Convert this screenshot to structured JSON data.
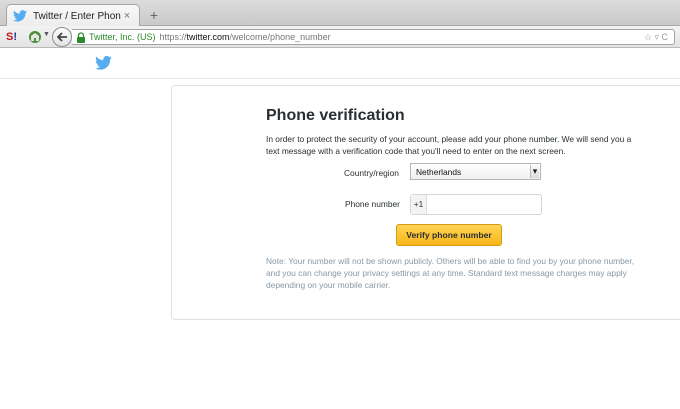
{
  "browser": {
    "tab_title": "Twitter / Enter Phone Number",
    "tab_close": "×",
    "new_tab": "+",
    "identity": "Twitter, Inc. (US)",
    "url_scheme": "https://",
    "url_domain": "twitter.com",
    "url_path": "/welcome/phone_number",
    "url_icons": "☆ ▿ C"
  },
  "page": {
    "title": "Phone verification",
    "description": "In order to protect the security of your account, please add your phone number. We will send you a text message with a verification code that you'll need to enter on the next screen.",
    "country_label": "Country/region",
    "country_value": "Netherlands",
    "phone_label": "Phone number",
    "phone_prefix": "+1",
    "phone_value": "",
    "verify_button": "Verify phone number",
    "note": "Note: Your number will not be shown publicly. Others will be able to find you by your phone number, and you can change your privacy settings at any time. Standard text message charges may apply depending on your mobile carrier."
  },
  "colors": {
    "twitter_blue": "#55acee",
    "button_yellow": "#f8b619",
    "secure_green": "#2b8a2b",
    "note_gray": "#8899a6"
  },
  "icons": [
    "twitter-bird-icon",
    "close-icon",
    "plus-icon",
    "back-arrow-icon",
    "lock-icon",
    "star-icon",
    "reload-icon",
    "dropdown-arrow-icon"
  ]
}
